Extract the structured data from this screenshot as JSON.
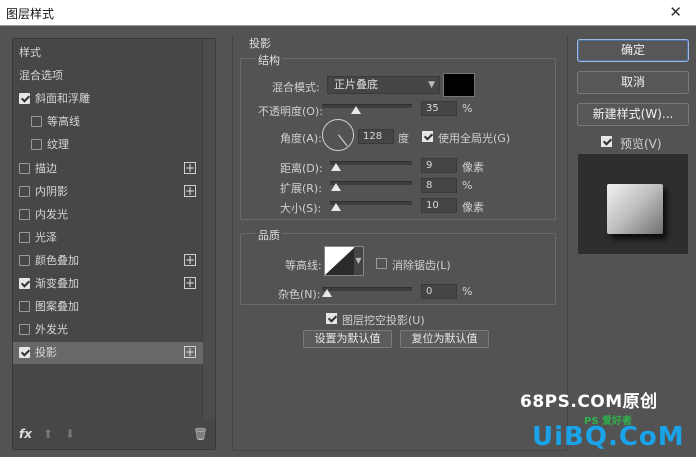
{
  "window": {
    "title": "图层样式",
    "close": "✕"
  },
  "left_panel": {
    "items": [
      {
        "label": "样式",
        "checkbox": false,
        "checked": false,
        "plus": false,
        "indent": 0
      },
      {
        "label": "混合选项",
        "checkbox": false,
        "checked": false,
        "plus": false,
        "indent": 0
      },
      {
        "label": "斜面和浮雕",
        "checkbox": true,
        "checked": true,
        "plus": false,
        "indent": 0
      },
      {
        "label": "等高线",
        "checkbox": true,
        "checked": false,
        "plus": false,
        "indent": 1
      },
      {
        "label": "纹理",
        "checkbox": true,
        "checked": false,
        "plus": false,
        "indent": 1
      },
      {
        "label": "描边",
        "checkbox": true,
        "checked": false,
        "plus": true,
        "indent": 0
      },
      {
        "label": "内阴影",
        "checkbox": true,
        "checked": false,
        "plus": true,
        "indent": 0
      },
      {
        "label": "内发光",
        "checkbox": true,
        "checked": false,
        "plus": false,
        "indent": 0
      },
      {
        "label": "光泽",
        "checkbox": true,
        "checked": false,
        "plus": false,
        "indent": 0
      },
      {
        "label": "颜色叠加",
        "checkbox": true,
        "checked": false,
        "plus": true,
        "indent": 0
      },
      {
        "label": "渐变叠加",
        "checkbox": true,
        "checked": true,
        "plus": true,
        "indent": 0
      },
      {
        "label": "图案叠加",
        "checkbox": true,
        "checked": false,
        "plus": false,
        "indent": 0
      },
      {
        "label": "外发光",
        "checkbox": true,
        "checked": false,
        "plus": false,
        "indent": 0
      },
      {
        "label": "投影",
        "checkbox": true,
        "checked": true,
        "plus": true,
        "indent": 0,
        "selected": true
      }
    ],
    "plus_glyph": "+",
    "bottom": {
      "fx": "fx",
      "up": "⬆",
      "down": "⬇",
      "trash": "🗑"
    }
  },
  "drop_shadow": {
    "section_title": "投影",
    "structure": {
      "title": "结构",
      "blend_mode_label": "混合模式:",
      "blend_mode_value": "正片叠底",
      "color": "#000000",
      "opacity_label": "不透明度(O):",
      "opacity_value": "35",
      "opacity_unit": "%",
      "angle_label": "角度(A):",
      "angle_value": "128",
      "angle_unit": "度",
      "global_light_label": "使用全局光(G)",
      "global_light_checked": true,
      "distance_label": "距离(D):",
      "distance_value": "9",
      "distance_unit": "像素",
      "spread_label": "扩展(R):",
      "spread_value": "8",
      "spread_unit": "%",
      "size_label": "大小(S):",
      "size_value": "10",
      "size_unit": "像素"
    },
    "quality": {
      "title": "品质",
      "contour_label": "等高线:",
      "antialias_label": "消除锯齿(L)",
      "antialias_checked": false,
      "noise_label": "杂色(N):",
      "noise_value": "0",
      "noise_unit": "%"
    },
    "knockout_label": "图层挖空投影(U)",
    "knockout_checked": true,
    "make_default": "设置为默认值",
    "reset_default": "复位为默认值"
  },
  "buttons": {
    "ok": "确定",
    "cancel": "取消",
    "new_style": "新建样式(W)...",
    "preview_label": "预览(V)",
    "preview_checked": true
  },
  "watermark": {
    "line1": "68PS.COM原创",
    "line2": "UiBQ.CoM",
    "line2_small": "PS 爱好者"
  },
  "colors": {
    "accent_blue": "#4c6fa8",
    "panel_bg": "#535353",
    "list_selected": "#686868",
    "watermark_blue": "#1aa3e8",
    "watermark_green": "#2fb14a"
  }
}
